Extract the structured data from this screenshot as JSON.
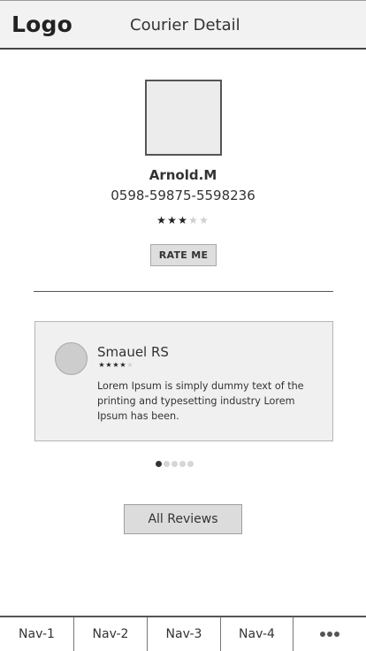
{
  "header": {
    "logo": "Logo",
    "title": "Courier Detail"
  },
  "courier": {
    "name": "Arnold.M",
    "phone": "0598-59875-5598236",
    "rating": 3,
    "rating_max": 5,
    "rate_button_label": "RATE ME"
  },
  "review": {
    "author": "Smauel RS",
    "rating": 4,
    "rating_max": 5,
    "text": "Lorem Ipsum is simply dummy text of the printing and typesetting industry Lorem Ipsum has been."
  },
  "pagination": {
    "active_index": 0,
    "count": 5
  },
  "all_reviews_label": "All Reviews",
  "nav": {
    "items": [
      {
        "label": "Nav-1"
      },
      {
        "label": "Nav-2"
      },
      {
        "label": "Nav-3"
      },
      {
        "label": "Nav-4"
      }
    ],
    "more_icon": "more-dots-icon"
  }
}
